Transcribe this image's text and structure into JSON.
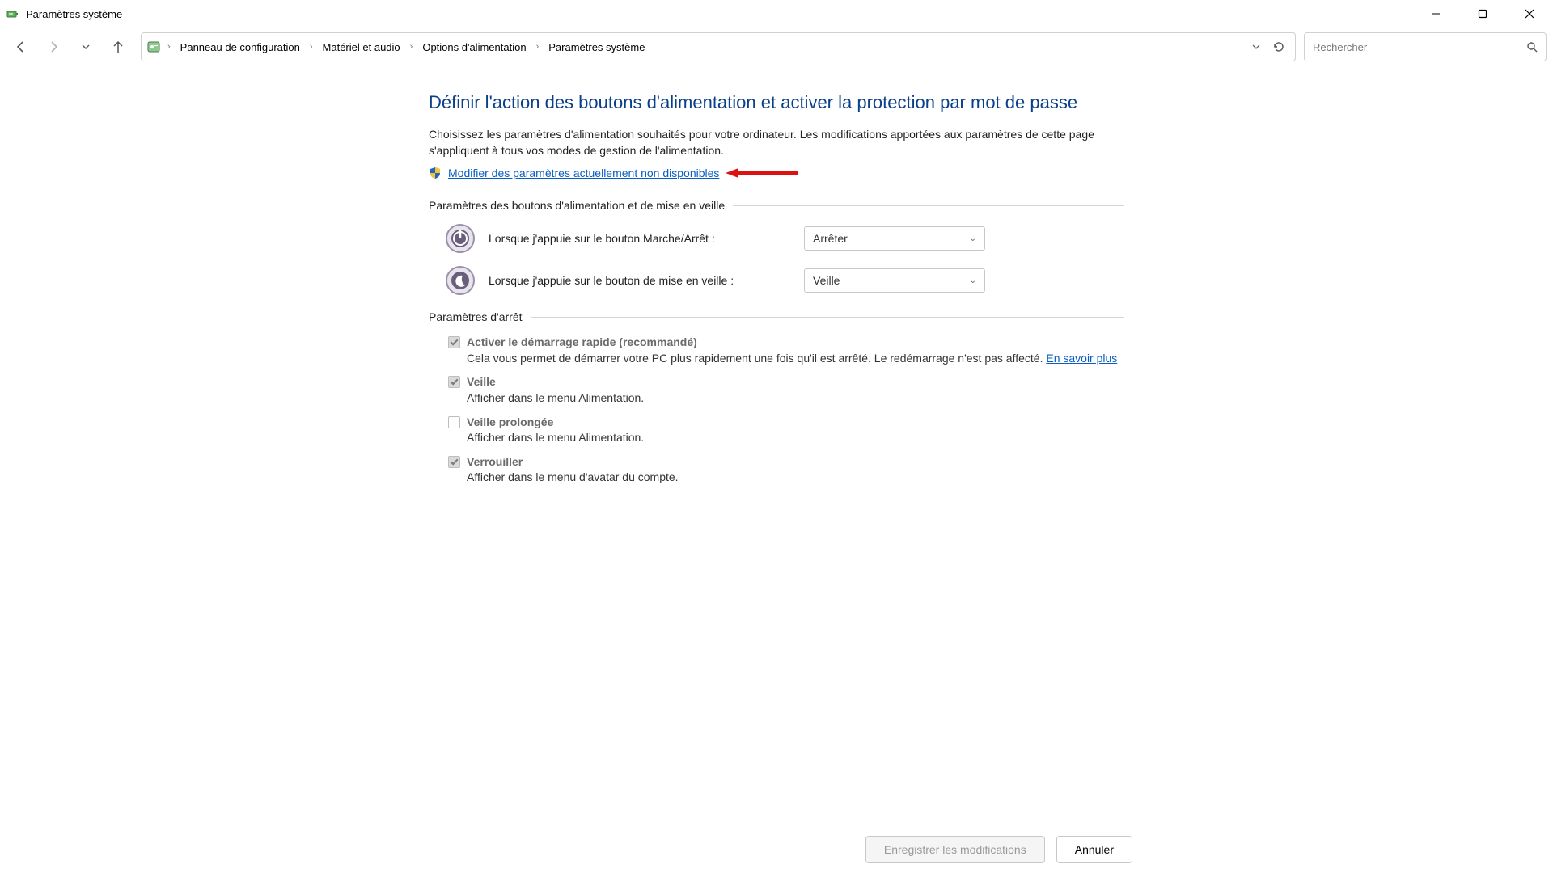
{
  "window": {
    "title": "Paramètres système"
  },
  "breadcrumb": {
    "seg0": "Panneau de configuration",
    "seg1": "Matériel et audio",
    "seg2": "Options d'alimentation",
    "seg3": "Paramètres système"
  },
  "search": {
    "placeholder": "Rechercher"
  },
  "heading": "Définir l'action des boutons d'alimentation et activer la protection par mot de passe",
  "description": "Choisissez les paramètres d'alimentation souhaités pour votre ordinateur. Les modifications apportées aux paramètres de cette page s'appliquent à tous vos modes de gestion de l'alimentation.",
  "uac_link": "Modifier des paramètres actuellement non disponibles",
  "section1_label": "Paramètres des boutons d'alimentation et de mise en veille",
  "power_button": {
    "label": "Lorsque j'appuie sur le bouton Marche/Arrêt :",
    "value": "Arrêter"
  },
  "sleep_button": {
    "label": "Lorsque j'appuie sur le bouton de mise en veille :",
    "value": "Veille"
  },
  "section2_label": "Paramètres d'arrêt",
  "shutdown": {
    "fast": {
      "title": "Activer le démarrage rapide (recommandé)",
      "sub": "Cela vous permet de démarrer votre PC plus rapidement une fois qu'il est arrêté. Le redémarrage n'est pas affecté. ",
      "link": "En savoir plus"
    },
    "sleep": {
      "title": "Veille",
      "sub": "Afficher dans le menu Alimentation."
    },
    "hibernate": {
      "title": "Veille prolongée",
      "sub": "Afficher dans le menu Alimentation."
    },
    "lock": {
      "title": "Verrouiller",
      "sub": "Afficher dans le menu d'avatar du compte."
    }
  },
  "buttons": {
    "save": "Enregistrer les modifications",
    "cancel": "Annuler"
  }
}
